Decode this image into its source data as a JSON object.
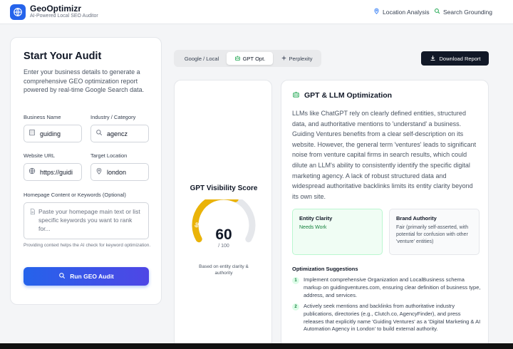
{
  "header": {
    "brand_name": "GeoOptimizr",
    "brand_sub": "AI-Powered Local SEO Auditor",
    "nav": [
      {
        "label": "Location Analysis",
        "icon": "map-pin-icon"
      },
      {
        "label": "Search Grounding",
        "icon": "search-icon"
      }
    ]
  },
  "audit_form": {
    "title": "Start Your Audit",
    "description": "Enter your business details to generate a comprehensive GEO optimization report powered by real-time Google Search data.",
    "business_name": {
      "label": "Business Name",
      "value": "guiding"
    },
    "industry": {
      "label": "Industry / Category",
      "value": "agencz"
    },
    "website": {
      "label": "Website URL",
      "value": "https://guidi"
    },
    "location": {
      "label": "Target Location",
      "value": "london"
    },
    "content": {
      "label": "Homepage Content or Keywords (Optional)",
      "placeholder": "Paste your homepage main text or list specific keywords you want to rank for..."
    },
    "hint": "Providing context helps the AI check for keyword optimization.",
    "run_button": "Run GEO Audit"
  },
  "tabs": [
    {
      "label": "Google / Local",
      "active": false
    },
    {
      "label": "GPT Opt.",
      "active": true
    },
    {
      "label": "Perplexity",
      "active": false
    }
  ],
  "download_button": "Download Report",
  "score": {
    "title": "GPT Visibility Score",
    "value": "60",
    "max": "/ 100",
    "gauge_label": "60",
    "fraction": 0.6,
    "note": "Based on entity clarity & authority",
    "color": "#eab308"
  },
  "analysis": {
    "title": "GPT & LLM Optimization",
    "body": "LLMs like ChatGPT rely on clearly defined entities, structured data, and authoritative mentions to 'understand' a business. Guiding Ventures benefits from a clear self-description on its website. However, the general term 'ventures' leads to significant noise from venture capital firms in search results, which could dilute an LLM's ability to consistently identify the specific digital marketing agency. A lack of robust structured data and widespread authoritative backlinks limits its entity clarity beyond its own site.",
    "entity_clarity": {
      "title": "Entity Clarity",
      "value": "Needs Work"
    },
    "brand_authority": {
      "title": "Brand Authority",
      "value": "Fair (primarily self-asserted, with potential for confusion with other 'venture' entities)"
    },
    "suggestions_title": "Optimization Suggestions",
    "suggestions": [
      {
        "num": "1",
        "text": "Implement comprehensive Organization and LocalBusiness schema markup on guidingventures.com, ensuring clear definition of business type, address, and services."
      },
      {
        "num": "2",
        "text": "Actively seek mentions and backlinks from authoritative industry publications, directories (e.g., Clutch.co, AgencyFinder), and press releases that explicitly name 'Guiding Ventures' as a 'Digital Marketing & AI Automation Agency in London' to build external authority."
      }
    ]
  }
}
